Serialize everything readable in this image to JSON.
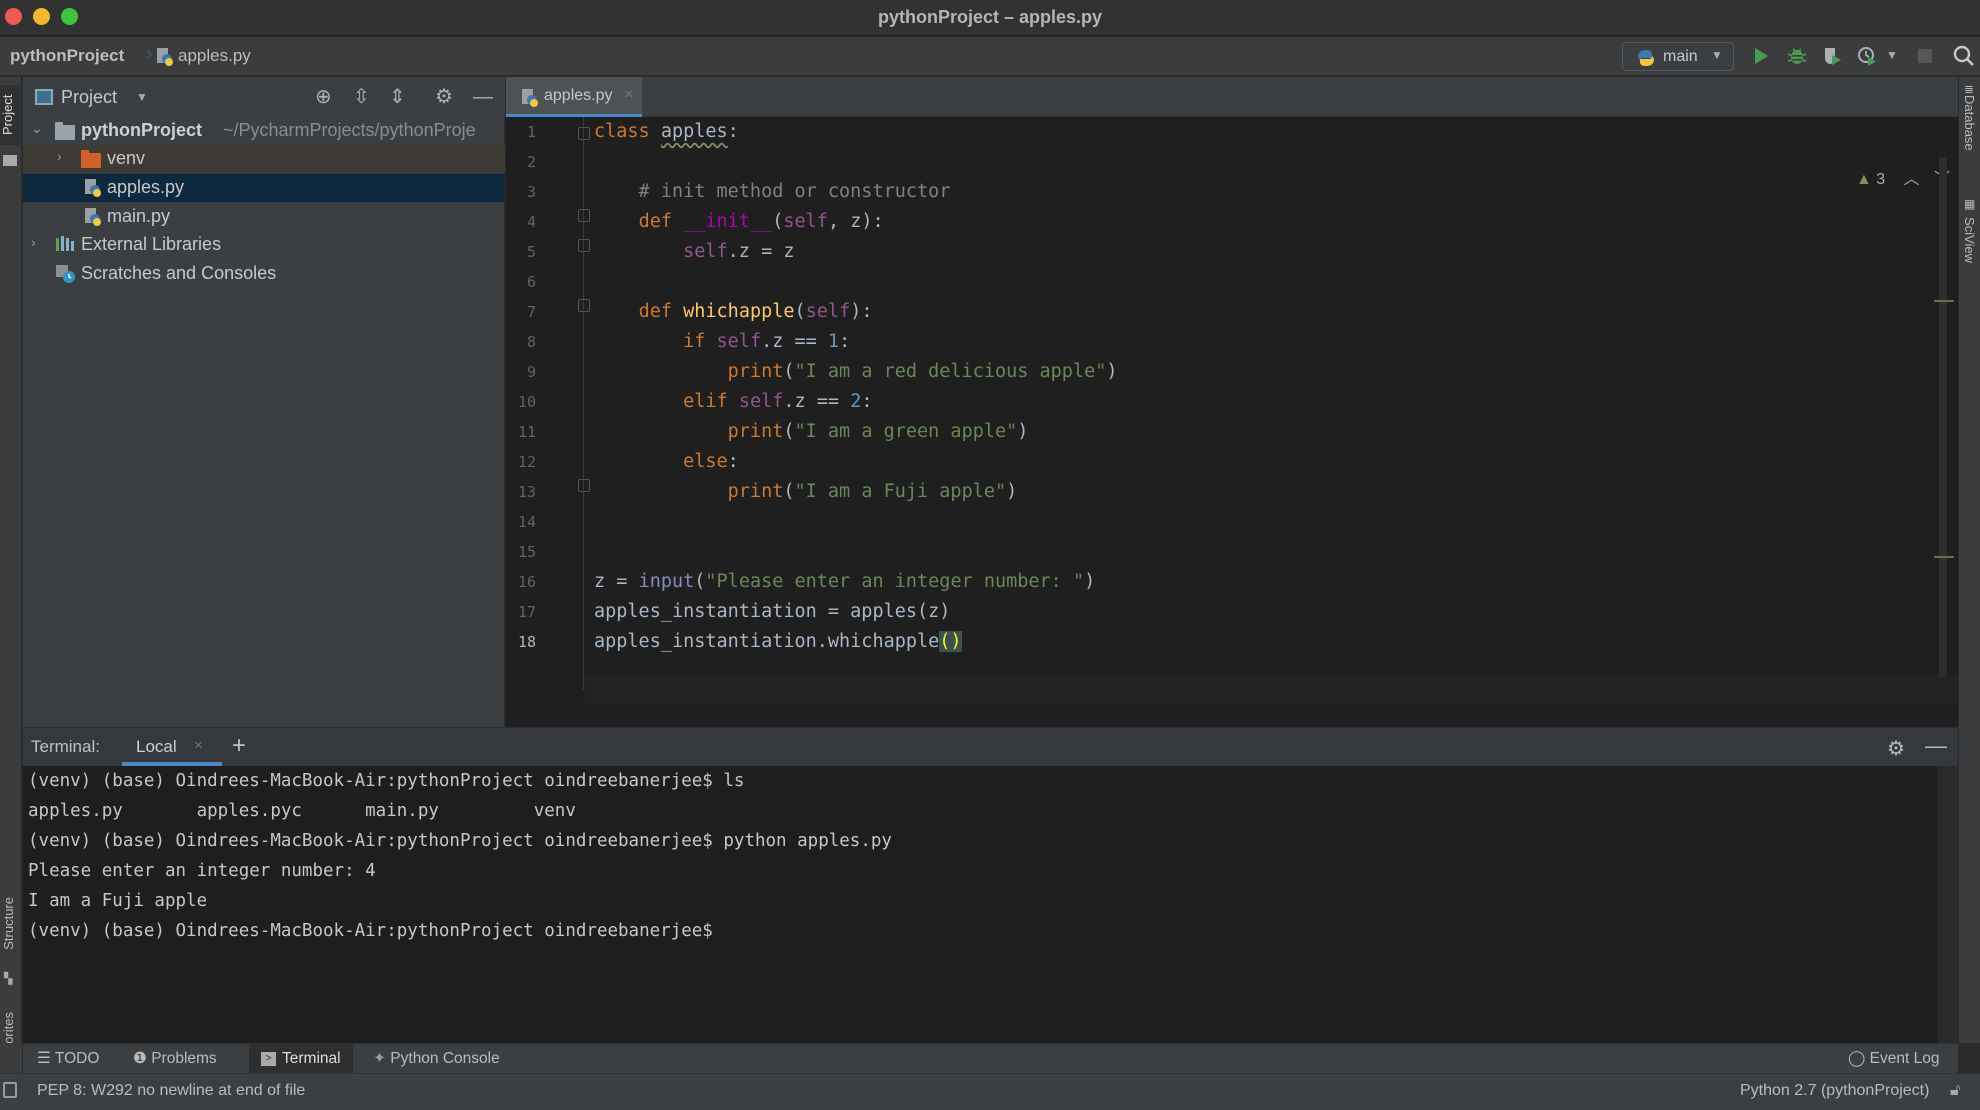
{
  "window": {
    "title": "pythonProject – apples.py"
  },
  "navbar": {
    "breadcrumb": [
      "pythonProject",
      "apples.py"
    ],
    "run_config": "main",
    "buttons": [
      "run",
      "debug",
      "coverage",
      "profile",
      "stop",
      "search"
    ]
  },
  "left_strip": {
    "tabs": [
      "Project",
      "Structure",
      "Favorites"
    ]
  },
  "right_strip": {
    "tabs": [
      "Database",
      "SciView"
    ]
  },
  "project_panel": {
    "title": "Project",
    "tree": [
      {
        "label": "pythonProject",
        "path": "~/PycharmProjects/pythonProje",
        "type": "root-folder",
        "expanded": true
      },
      {
        "label": "venv",
        "type": "excluded-folder",
        "expanded": false
      },
      {
        "label": "apples.py",
        "type": "python-file",
        "selected": true
      },
      {
        "label": "main.py",
        "type": "python-file"
      },
      {
        "label": "External Libraries",
        "type": "libraries",
        "expanded": false
      },
      {
        "label": "Scratches and Consoles",
        "type": "scratches"
      }
    ]
  },
  "editor": {
    "tabs": [
      {
        "label": "apples.py",
        "active": true
      }
    ],
    "inspection_count": "3",
    "current_line": 18,
    "lines": [
      "class apples:",
      "",
      "    # init method or constructor",
      "    def __init__(self, z):",
      "        self.z = z",
      "",
      "    def whichapple(self):",
      "        if self.z == 1:",
      "            print(\"I am a red delicious apple\")",
      "        elif self.z == 2:",
      "            print(\"I am a green apple\")",
      "        else:",
      "            print(\"I am a Fuji apple\")",
      "",
      "",
      "z = input(\"Please enter an integer number: \")",
      "apples_instantiation = apples(z)",
      "apples_instantiation.whichapple()"
    ],
    "line_numbers": [
      "1",
      "2",
      "3",
      "4",
      "5",
      "6",
      "7",
      "8",
      "9",
      "10",
      "11",
      "12",
      "13",
      "14",
      "15",
      "16",
      "17",
      "18"
    ]
  },
  "terminal": {
    "title": "Terminal:",
    "tabs": [
      {
        "label": "Local",
        "active": true
      }
    ],
    "add_label": "+",
    "lines": [
      "(venv) (base) Oindrees-MacBook-Air:pythonProject oindreebanerjee$ ls",
      "apples.py       apples.pyc      main.py         venv",
      "(venv) (base) Oindrees-MacBook-Air:pythonProject oindreebanerjee$ python apples.py",
      "Please enter an integer number: 4",
      "I am a Fuji apple",
      "(venv) (base) Oindrees-MacBook-Air:pythonProject oindreebanerjee$"
    ]
  },
  "bottom_tabs": {
    "todo": "TODO",
    "problems": "Problems",
    "terminal": "Terminal",
    "python_console": "Python Console",
    "event_log": "Event Log"
  },
  "statusbar": {
    "message": "PEP 8: W292 no newline at end of file",
    "interpreter": "Python 2.7 (pythonProject)"
  },
  "colors": {
    "accent": "#4a88c7",
    "run_green": "#499c54",
    "keyword": "#cc7832",
    "string": "#6a8759",
    "self": "#94558d",
    "function": "#ffc66d",
    "number": "#6897bb"
  }
}
